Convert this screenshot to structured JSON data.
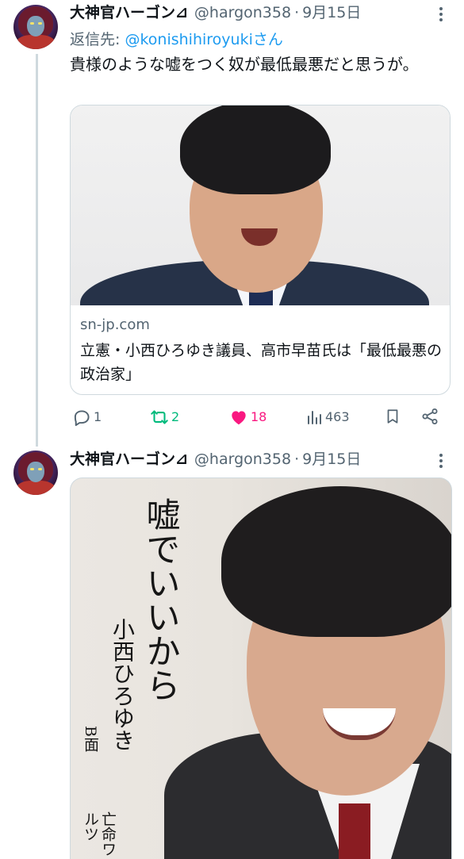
{
  "tweets": [
    {
      "author_name": "大神官ハーゴン⊿",
      "handle": "@hargon358",
      "separator": "·",
      "date": "9月15日",
      "reply_label": "返信先: ",
      "reply_mention": "@konishihiroyukiさん",
      "text": "貴様のような嘘をつく奴が最低最悪だと思うが。",
      "card": {
        "domain": "sn-jp.com",
        "title": "立憲・小西ひろゆき議員、高市早苗氏は「最低最悪の政治家」"
      },
      "actions": {
        "reply_count": "1",
        "retweet_count": "2",
        "like_count": "18",
        "view_count": "463"
      }
    },
    {
      "author_name": "大神官ハーゴン⊿",
      "handle": "@hargon358",
      "separator": "·",
      "date": "9月15日",
      "image_text": {
        "title": "嘘でいいから",
        "author": "小西ひろゆき",
        "side": "B面",
        "song": "亡命ワルツ"
      }
    }
  ],
  "colors": {
    "accent": "#1d9bf0",
    "like": "#f91880",
    "retweet": "#00ba7c",
    "secondary": "#536471",
    "border": "#cfd9de"
  },
  "icons": [
    "more-icon",
    "reply-icon",
    "retweet-icon",
    "like-icon",
    "views-icon",
    "bookmark-icon",
    "share-icon"
  ]
}
